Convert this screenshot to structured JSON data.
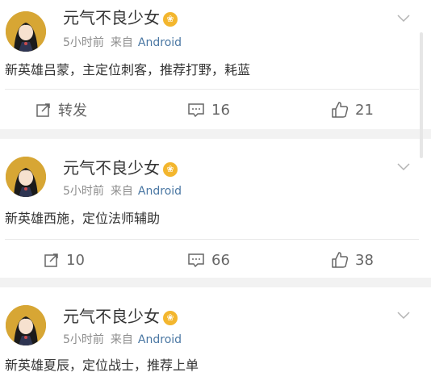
{
  "posts": [
    {
      "username": "元气不良少女",
      "badge": "❀",
      "time": "5小时前",
      "from_label": "来自",
      "source": "Android",
      "content": "新英雄吕蒙，主定位刺客，推荐打野，耗蓝",
      "repost_label": "转发",
      "comments": "16",
      "likes": "21"
    },
    {
      "username": "元气不良少女",
      "badge": "❀",
      "time": "5小时前",
      "from_label": "来自",
      "source": "Android",
      "content": "新英雄西施，定位法师辅助",
      "repost_count": "10",
      "comments": "66",
      "likes": "38"
    },
    {
      "username": "元气不良少女",
      "badge": "❀",
      "time": "5小时前",
      "from_label": "来自",
      "source": "Android",
      "content": "新英雄夏辰，定位战士，推荐上单"
    }
  ],
  "colors": {
    "accent_link": "#4a77a3",
    "badge": "#f3b62e",
    "divider": "#f2f2f2"
  },
  "icons": [
    "repost-icon",
    "comment-icon",
    "like-icon",
    "chevron-down-icon",
    "avatar"
  ]
}
